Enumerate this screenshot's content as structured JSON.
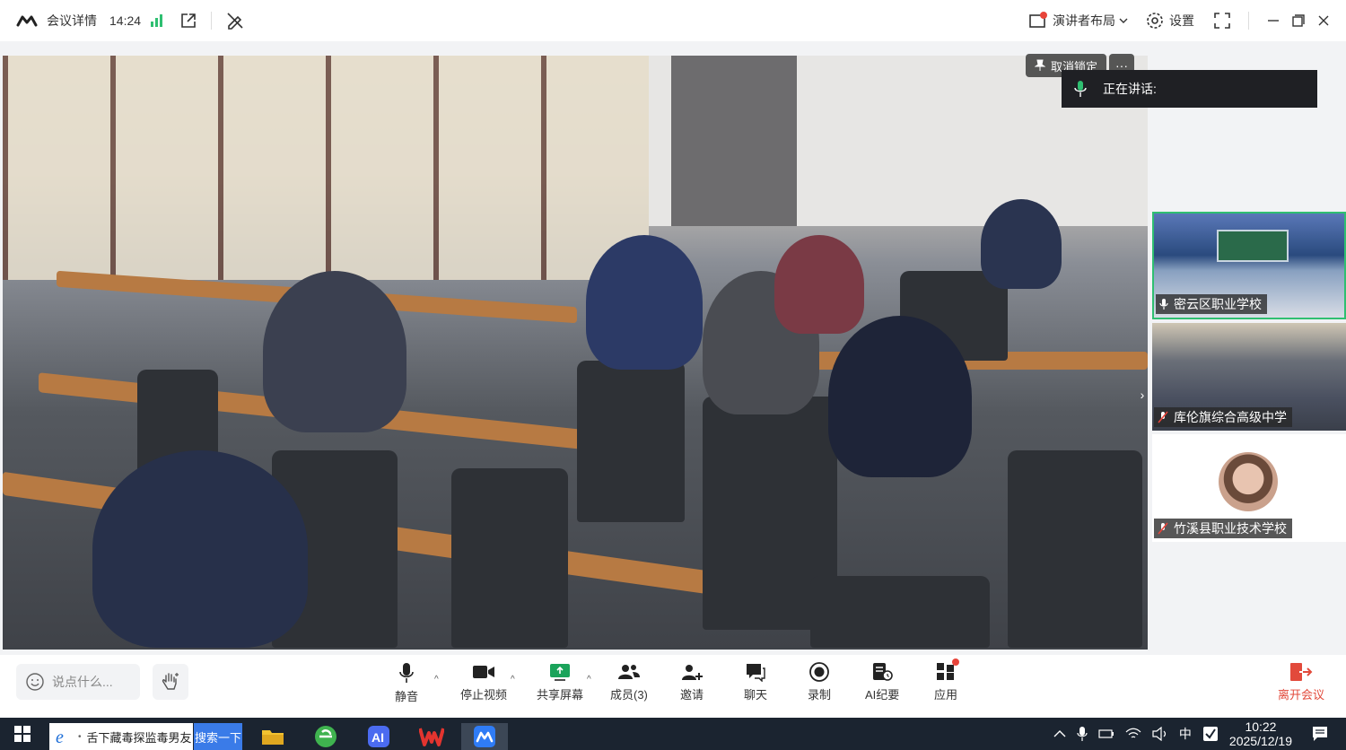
{
  "titlebar": {
    "meeting_details": "会议详情",
    "time": "14:24",
    "presenter_layout": "演讲者布局",
    "settings": "设置"
  },
  "stage": {
    "unlock_label": "取消锁定",
    "more_label": "···",
    "speaking_label": "正在讲话:"
  },
  "participants": [
    {
      "name": "密云区职业学校",
      "active": true
    },
    {
      "name": "库伦旗综合高级中学",
      "active": false
    },
    {
      "name": "竹溪县职业技术学校",
      "active": false
    }
  ],
  "toolbar": {
    "chat_placeholder": "说点什么...",
    "mute": "静音",
    "stop_video": "停止视频",
    "share_screen": "共享屏幕",
    "members": "成员(3)",
    "invite": "邀请",
    "chat": "聊天",
    "record": "录制",
    "ai_minutes": "AI纪要",
    "apps": "应用",
    "leave": "离开会议"
  },
  "taskbar": {
    "search_text": "舌下藏毒探监毒男友",
    "search_button": "搜索一下",
    "ime": "中",
    "clock_time": "10:22",
    "clock_date": "2025/12/19"
  },
  "colors": {
    "active_border": "#2fbf71",
    "leave_red": "#e24a3b",
    "taskbar": "#1b2430",
    "accent_blue": "#3a7be8"
  }
}
